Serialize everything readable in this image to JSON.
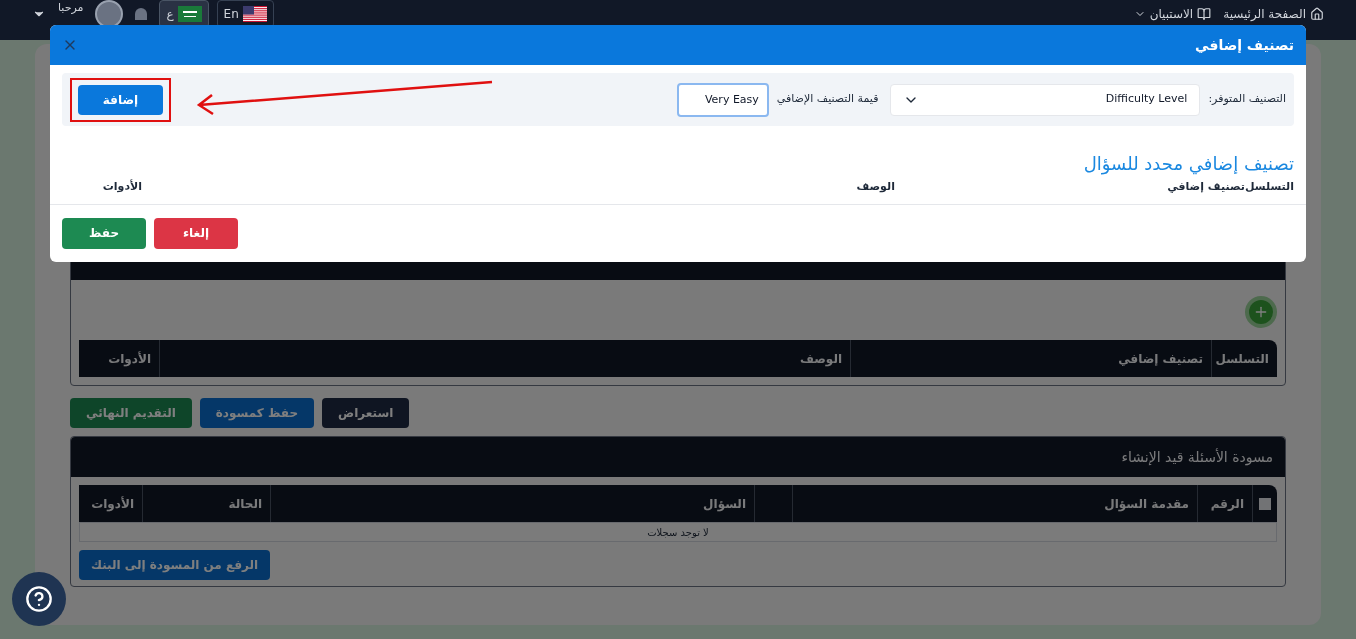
{
  "navbar": {
    "greeting": "مرحبا",
    "links": [
      {
        "label": "الصفحة الرئيسية",
        "kind": "home"
      },
      {
        "label": "الاستبيان",
        "kind": "menu"
      }
    ],
    "languages": [
      {
        "label": "En",
        "selected": false,
        "kind": "us"
      },
      {
        "label": "ع",
        "selected": true,
        "kind": "sa"
      }
    ]
  },
  "page": {
    "classification_table": {
      "columns": [
        "التسلسل",
        "تصنيف إضافي",
        "الوصف",
        "الأدوات"
      ]
    },
    "actions": [
      {
        "label": "استعراض",
        "kind": "dark"
      },
      {
        "label": "حفظ كمسودة",
        "kind": "primary"
      },
      {
        "label": "التقديم النهائي",
        "kind": "success"
      }
    ],
    "drafts": {
      "title": "مسودة الأسئلة قيد الإنشاء",
      "columns": [
        {
          "kind": "checkbox",
          "checked": false
        },
        {
          "kind": "text",
          "label": "الرقم"
        },
        {
          "kind": "text",
          "label": "مقدمة السؤال"
        },
        {
          "kind": "blank"
        },
        {
          "kind": "text",
          "label": "السؤال"
        },
        {
          "kind": "text",
          "label": "الحالة"
        },
        {
          "kind": "text",
          "label": "الأدوات"
        }
      ],
      "empty_message": "لا توجد سجلات",
      "upload_button": "الرفع من المسودة إلى البنك"
    }
  },
  "modal": {
    "title": "تصنيف إضافي",
    "available_label": "التصنيف المتوفر:",
    "available_value": "Difficulty Level",
    "value_label": "قيمة التصنيف الإضافي",
    "value_input": "Very Easy",
    "add_button": "إضافة",
    "section_title": "تصنيف إضافي محدد للسؤال",
    "columns": [
      "التسلسل",
      "تصنيف إضافي",
      "الوصف",
      "الأدوات"
    ],
    "buttons": [
      {
        "label": "إلغاء",
        "kind": "danger"
      },
      {
        "label": "حفظ",
        "kind": "success"
      }
    ]
  }
}
